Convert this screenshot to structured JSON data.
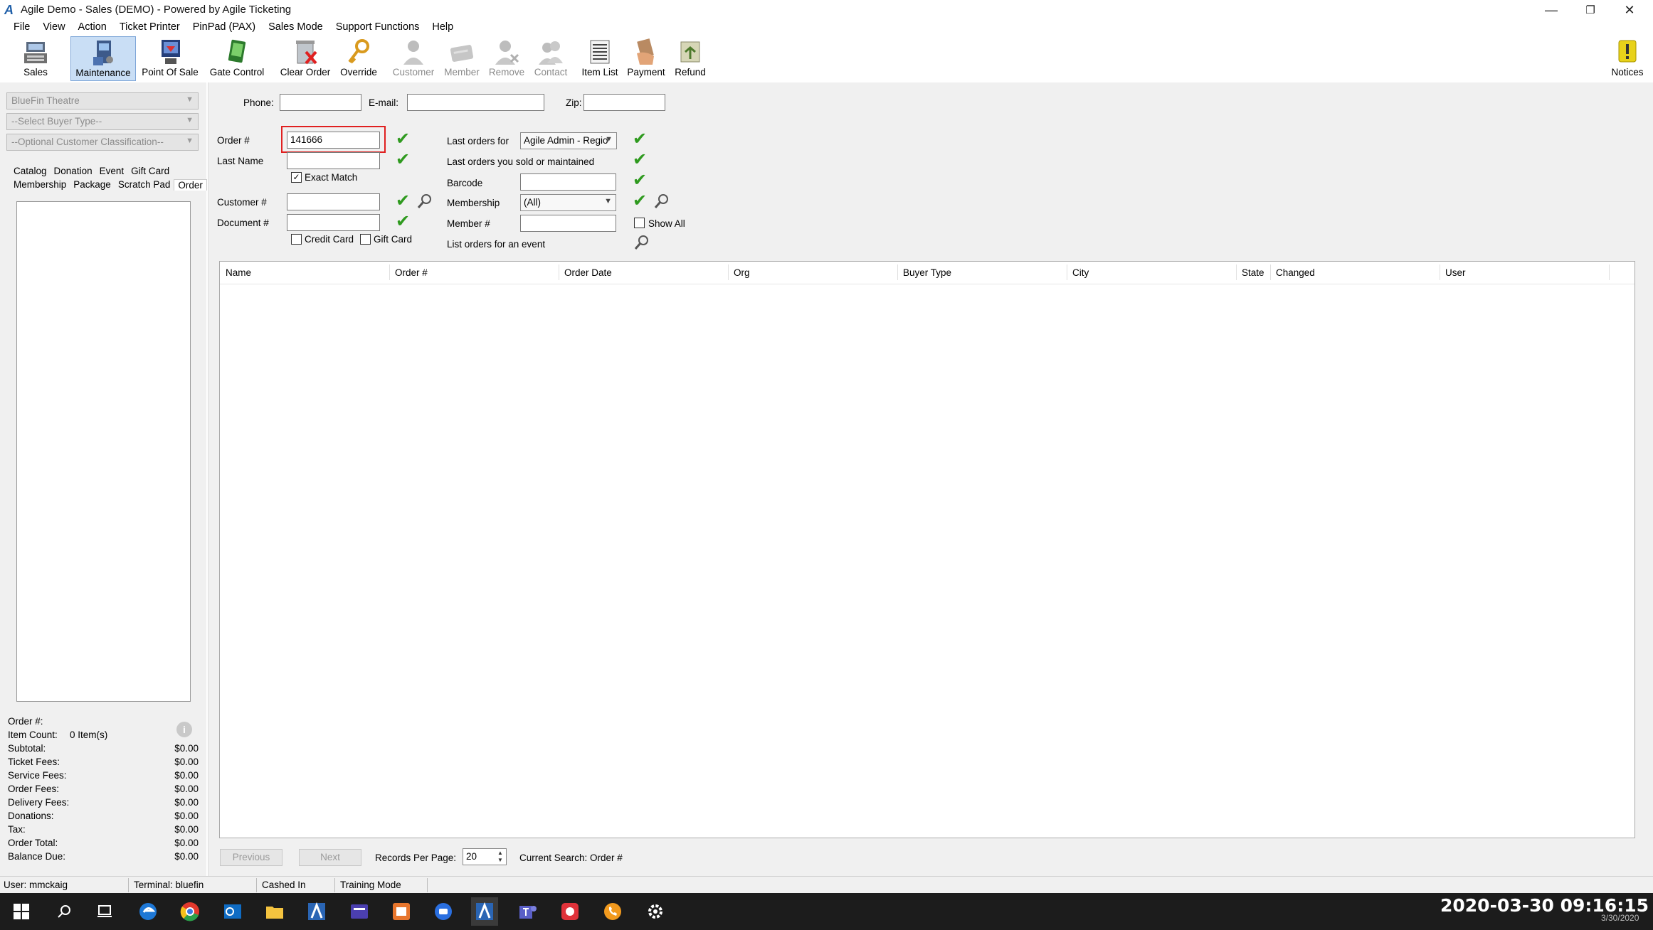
{
  "window": {
    "title": "Agile Demo - Sales (DEMO) - Powered by Agile Ticketing",
    "minimize": "—",
    "restore": "❐",
    "close": "✕"
  },
  "menu": [
    "File",
    "View",
    "Action",
    "Ticket Printer",
    "PinPad (PAX)",
    "Sales Mode",
    "Support Functions",
    "Help"
  ],
  "toolbar": {
    "sales": "Sales",
    "maintenance": "Maintenance",
    "point_of_sale": "Point Of Sale",
    "gate_control": "Gate Control",
    "clear_order": "Clear Order",
    "override": "Override",
    "customer": "Customer",
    "member": "Member",
    "remove": "Remove",
    "contact": "Contact",
    "item_list": "Item List",
    "payment": "Payment",
    "refund": "Refund",
    "notices": "Notices"
  },
  "left": {
    "venue_select": "BlueFin Theatre",
    "buyer_type_select": "--Select Buyer Type--",
    "classification_select": "--Optional Customer Classification--",
    "tabs_row1": [
      "Catalog",
      "Donation",
      "Event",
      "Gift Card"
    ],
    "tabs_row2": [
      "Membership",
      "Package",
      "Scratch Pad",
      "Order"
    ],
    "summary": {
      "order_label": "Order #:",
      "item_count_label": "Item Count:",
      "item_count_value": "0 Item(s)",
      "rows": [
        {
          "label": "Subtotal:",
          "value": "$0.00"
        },
        {
          "label": "Ticket Fees:",
          "value": "$0.00"
        },
        {
          "label": "Service Fees:",
          "value": "$0.00"
        },
        {
          "label": "Order Fees:",
          "value": "$0.00"
        },
        {
          "label": "Delivery Fees:",
          "value": "$0.00"
        },
        {
          "label": "Donations:",
          "value": "$0.00"
        },
        {
          "label": "Tax:",
          "value": "$0.00"
        },
        {
          "label": "Order Total:",
          "value": "$0.00"
        },
        {
          "label": "Balance Due:",
          "value": "$0.00"
        }
      ]
    }
  },
  "search": {
    "phone_label": "Phone:",
    "email_label": "E-mail:",
    "zip_label": "Zip:",
    "order_label": "Order #",
    "order_value": "141666",
    "last_name_label": "Last Name",
    "exact_match_label": "Exact Match",
    "customer_label": "Customer #",
    "document_label": "Document #",
    "credit_card_label": "Credit Card",
    "gift_card_label": "Gift Card",
    "last_orders_for_label": "Last orders for",
    "last_orders_for_value": "Agile Admin - Regio",
    "last_orders_sold_label": "Last orders you sold or maintained",
    "barcode_label": "Barcode",
    "membership_label": "Membership",
    "membership_value": "(All)",
    "member_label": "Member #",
    "show_all_label": "Show All",
    "list_orders_event_label": "List orders for an event"
  },
  "grid": {
    "columns": [
      "Name",
      "Order #",
      "Order Date",
      "Org",
      "Buyer Type",
      "City",
      "State",
      "Changed",
      "User"
    ]
  },
  "pager": {
    "previous": "Previous",
    "next": "Next",
    "records_per_page_label": "Records Per Page:",
    "records_per_page_value": "20",
    "current_search": "Current Search: Order #"
  },
  "status": {
    "user": "User: mmckaig",
    "terminal": "Terminal: bluefin",
    "cashed_in": "Cashed In",
    "training_mode": "Training Mode"
  },
  "taskbar": {
    "clock": "2020-03-30  09:16:15",
    "date_small": "3/30/2020",
    "icons": [
      "windows-start-icon",
      "search-icon",
      "task-view-icon",
      "edge-icon",
      "chrome-icon",
      "outlook-icon",
      "file-explorer-icon",
      "agile-icon",
      "media-app-icon",
      "outlook-app-icon",
      "chat-app-icon",
      "agile-active-icon",
      "teams-icon",
      "red-app-icon",
      "phone-app-icon",
      "settings-icon"
    ]
  },
  "colors": {
    "check_green": "#2f9a1f",
    "highlight_red": "#e02020",
    "active_tab_bg": "#c9def5",
    "taskbar_bg": "#1c1c1c"
  }
}
